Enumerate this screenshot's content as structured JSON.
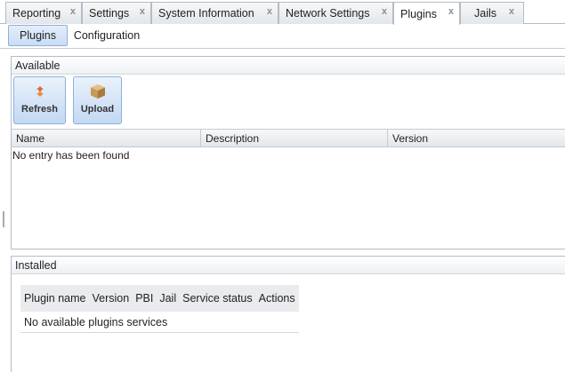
{
  "tabs": [
    {
      "label": "Reporting",
      "close": "x"
    },
    {
      "label": "Settings",
      "close": "x"
    },
    {
      "label": "System Information",
      "close": "x"
    },
    {
      "label": "Network Settings",
      "close": "x"
    },
    {
      "label": "Plugins",
      "close": "x",
      "active": true
    },
    {
      "label": "Jails",
      "close": "x"
    }
  ],
  "subtabs": {
    "plugins": "Plugins",
    "configuration": "Configuration"
  },
  "available": {
    "title": "Available",
    "refresh_label": "Refresh",
    "upload_label": "Upload",
    "columns": [
      "Name",
      "Description",
      "Version"
    ],
    "empty_text": "No entry has been found"
  },
  "installed": {
    "title": "Installed",
    "columns": [
      "Plugin name",
      "Version",
      "PBI",
      "Jail",
      "Service status",
      "Actions"
    ],
    "empty_text": "No available plugins services"
  },
  "colors": {
    "accent": "#c9dcf5",
    "border": "#b5bcc7",
    "refresh_icon": "#e06a2c",
    "upload_icon": "#c79a55"
  }
}
